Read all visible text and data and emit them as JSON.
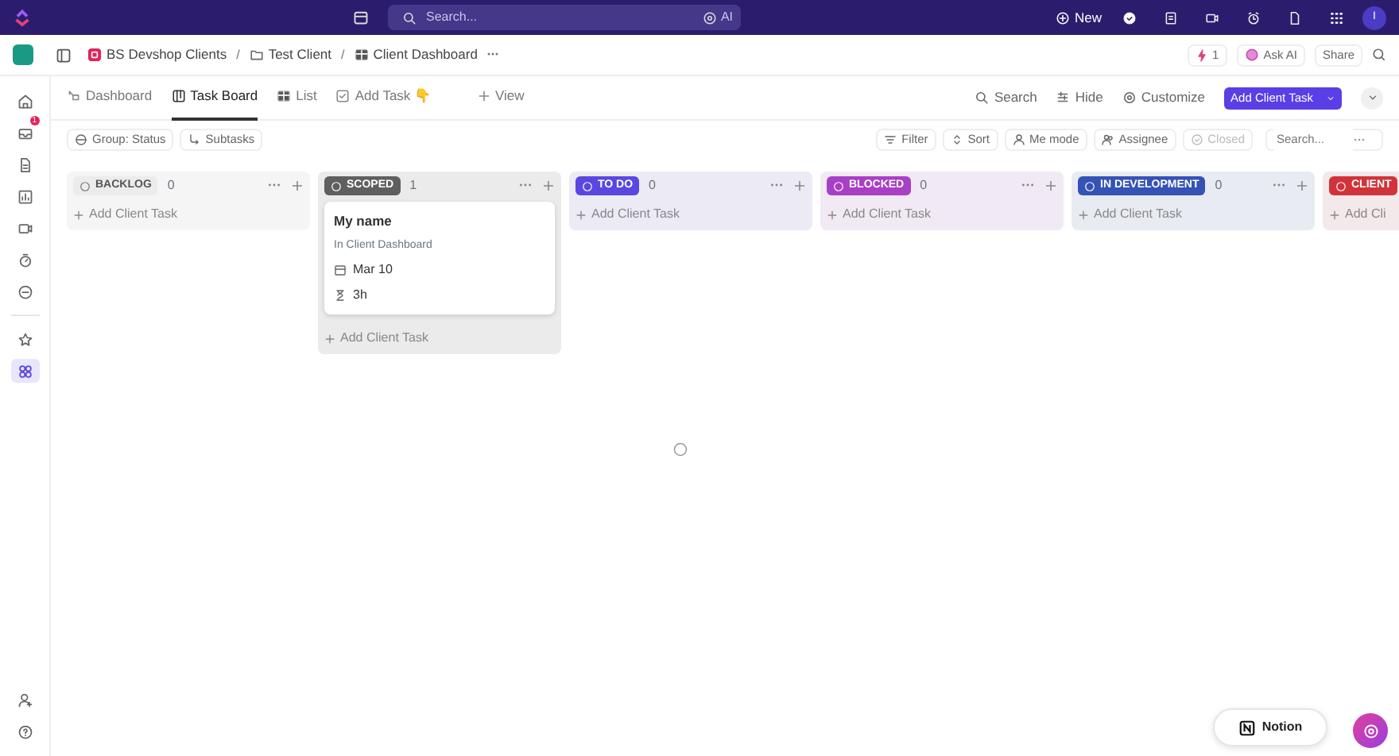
{
  "topbar": {
    "search_placeholder": "Search...",
    "ai_label": "AI",
    "new_label": "New",
    "avatar_initial": "I"
  },
  "breadcrumb": {
    "items": [
      {
        "kind": "space",
        "text": "BS Devshop Clients"
      },
      {
        "kind": "folder",
        "text": "Test Client"
      },
      {
        "kind": "list",
        "text": "Client Dashboard"
      }
    ],
    "separator": "/",
    "notification_count": "1",
    "ask_ai": "Ask AI",
    "share": "Share"
  },
  "sidebar": {
    "items": [
      {
        "kind": "home",
        "selected": false
      },
      {
        "kind": "inbox",
        "selected": false,
        "badge": "1"
      },
      {
        "kind": "docs",
        "selected": false
      },
      {
        "kind": "chart",
        "selected": false
      },
      {
        "kind": "video",
        "selected": false
      },
      {
        "kind": "timer",
        "selected": false
      },
      {
        "kind": "more",
        "selected": false
      },
      {
        "kind": "star",
        "selected": false
      },
      {
        "kind": "grid",
        "selected": true
      }
    ],
    "bottom": [
      {
        "kind": "user-plus"
      },
      {
        "kind": "help"
      }
    ]
  },
  "views": {
    "tabs": [
      {
        "kind": "dashboard",
        "label": "Dashboard",
        "selected": false
      },
      {
        "kind": "board",
        "label": "Task Board",
        "selected": true
      },
      {
        "kind": "list",
        "label": "List",
        "selected": false
      },
      {
        "kind": "form",
        "label": "Add Task 👇",
        "selected": false
      },
      {
        "kind": "plus",
        "label": "View",
        "selected": false
      }
    ],
    "search": "Search",
    "hide": "Hide",
    "customize": "Customize",
    "add_button": "Add Client Task"
  },
  "filters": {
    "left": [
      {
        "kind": "group",
        "label": "Group: Status"
      },
      {
        "kind": "subtasks",
        "label": "Subtasks"
      }
    ],
    "right": [
      {
        "kind": "filter",
        "label": "Filter",
        "disabled": false
      },
      {
        "kind": "sort",
        "label": "Sort",
        "disabled": false
      },
      {
        "kind": "me",
        "label": "Me mode",
        "disabled": false
      },
      {
        "kind": "assignee",
        "label": "Assignee",
        "disabled": false
      },
      {
        "kind": "closed",
        "label": "Closed",
        "disabled": true
      }
    ],
    "search_placeholder": "Search..."
  },
  "columns": [
    {
      "name": "BACKLOG",
      "kind": "outline",
      "color": "#ececec",
      "count": "0",
      "add_label": "Add Client Task"
    },
    {
      "name": "SCOPED",
      "kind": "filled",
      "color": "#5f5f5f",
      "count": "1",
      "add_label": "Add Client Task",
      "cards": [
        {
          "title": "My name",
          "location": "In Client Dashboard",
          "date": "Mar 10",
          "estimate": "3h"
        }
      ]
    },
    {
      "name": "TO DO",
      "kind": "filled",
      "color": "#5a47e0",
      "count": "0",
      "add_label": "Add Client Task"
    },
    {
      "name": "BLOCKED",
      "kind": "filled",
      "color": "#a83fc4",
      "count": "0",
      "add_label": "Add Client Task"
    },
    {
      "name": "IN DEVELOPMENT",
      "kind": "filled",
      "color": "#3552b5",
      "count": "0",
      "add_label": "Add Client Task"
    },
    {
      "name": "CLIENT",
      "kind": "filled",
      "color": "#d0343a",
      "add_label": "Add Cli"
    }
  ],
  "notion_label": "Notion"
}
